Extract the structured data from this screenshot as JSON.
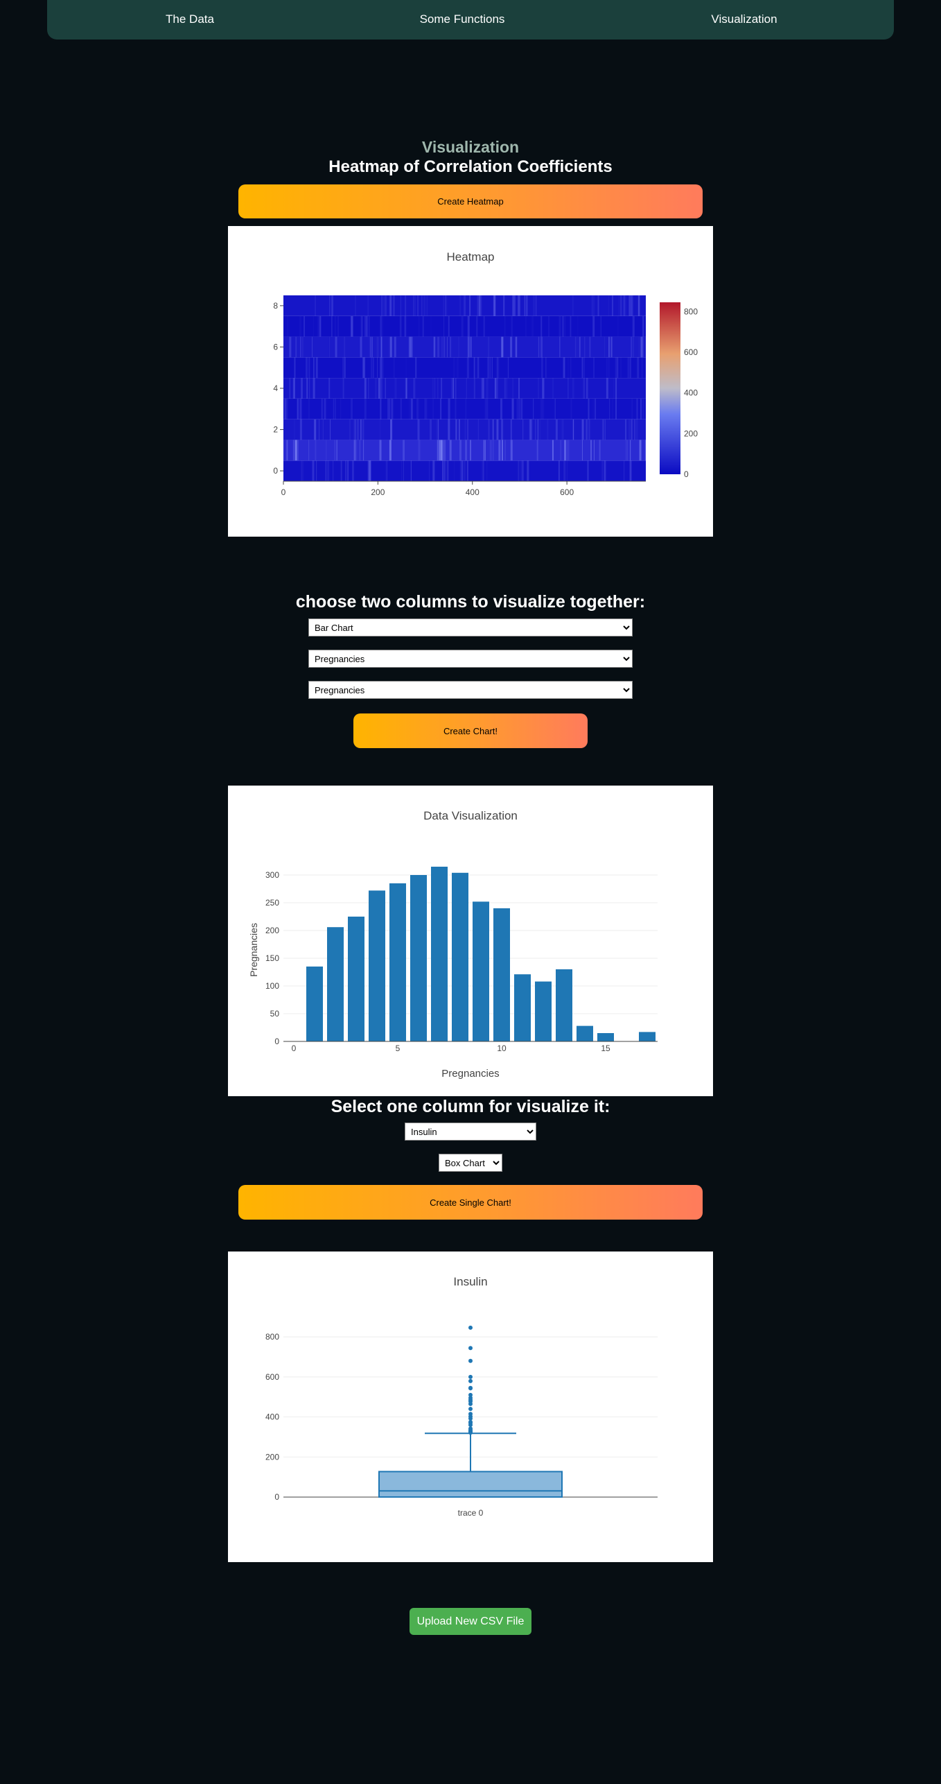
{
  "nav": {
    "items": [
      "The Data",
      "Some Functions",
      "Visualization"
    ]
  },
  "page": {
    "section_title": "Visualization",
    "heatmap_heading": "Heatmap of Correlation Coefficients",
    "heatmap_button": "Create Heatmap",
    "pair_heading": "choose two columns to visualize together:",
    "chart_button": "Create Chart!",
    "single_heading": "Select one column for visualize it:",
    "single_button": "Create Single Chart!",
    "upload_button": "Upload New CSV File"
  },
  "pair_selects": {
    "chart_type": "Bar Chart",
    "column_x": "Pregnancies",
    "column_y": "Pregnancies"
  },
  "single_selects": {
    "column": "Insulin",
    "chart_type": "Box Chart"
  },
  "colors": {
    "nav_bg": "#1b403c",
    "page_bg": "#070e13",
    "accent_start": "#ffb400",
    "accent_end": "#ff7b5c",
    "plot_blue": "#1f77b4",
    "heat_low": "#0a0ac2",
    "heat_high": "#b2182b",
    "upload_green": "#4caf50"
  },
  "chart_data": [
    {
      "type": "heatmap",
      "title": "Heatmap",
      "x_ticks": [
        0,
        200,
        400,
        600
      ],
      "y_ticks": [
        0,
        2,
        4,
        6,
        8
      ],
      "xlim": [
        0,
        767
      ],
      "ylim": [
        -0.5,
        8.5
      ],
      "colorbar": {
        "ticks": [
          0,
          200,
          400,
          600,
          800
        ],
        "range": [
          0,
          846
        ]
      },
      "row_intensity": [
        0.15,
        0.55,
        0.25,
        0.12,
        0.2,
        0.1,
        0.28,
        0.08,
        0.2
      ]
    },
    {
      "type": "bar",
      "title": "Data Visualization",
      "xlabel": "Pregnancies",
      "ylabel": "Pregnancies",
      "x": [
        1,
        2,
        3,
        4,
        5,
        6,
        7,
        8,
        9,
        10,
        11,
        12,
        13,
        14,
        15,
        17
      ],
      "values": [
        135,
        206,
        225,
        272,
        285,
        300,
        315,
        304,
        252,
        240,
        121,
        108,
        130,
        28,
        15,
        17
      ],
      "x_ticks": [
        0,
        5,
        10,
        15
      ],
      "y_ticks": [
        0,
        50,
        100,
        150,
        200,
        250,
        300
      ],
      "xlim": [
        -0.5,
        17.5
      ],
      "ylim": [
        0,
        330
      ]
    },
    {
      "type": "box",
      "title": "Insulin",
      "category": "trace 0",
      "y_ticks": [
        0,
        200,
        400,
        600,
        800
      ],
      "ylim": [
        -10,
        880
      ],
      "min": 0,
      "q1": 0,
      "median": 30.5,
      "q3": 127,
      "upper_fence": 318,
      "outliers": [
        321,
        326,
        328,
        330,
        335,
        342,
        360,
        370,
        375,
        392,
        402,
        415,
        440,
        465,
        478,
        485,
        495,
        510,
        543,
        545,
        579,
        600,
        680,
        744,
        846
      ]
    }
  ]
}
